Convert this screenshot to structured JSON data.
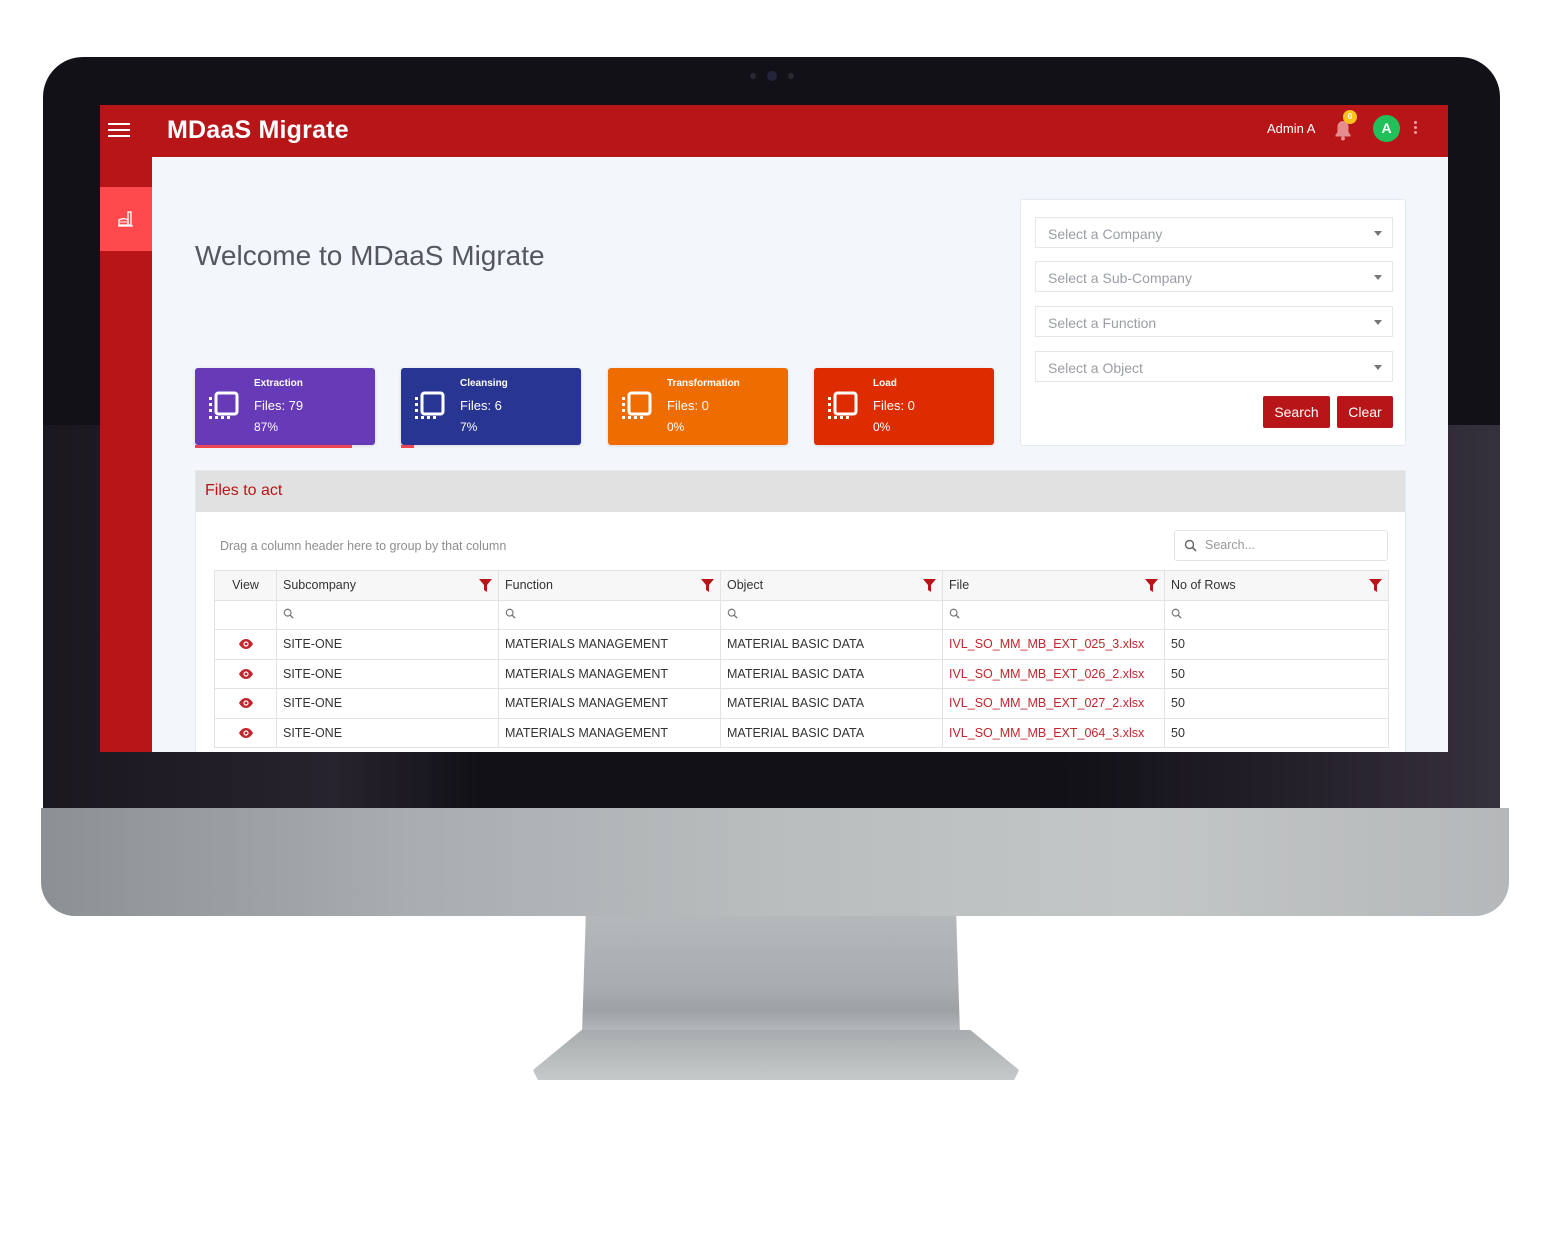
{
  "app": {
    "title": "MDaaS Migrate",
    "user_name": "Admin A",
    "notification_count": "0",
    "avatar_initial": "A",
    "brand_color": "#b71518"
  },
  "sidebar": {
    "items": [
      {
        "icon": "factory-icon",
        "active": true
      }
    ]
  },
  "main": {
    "welcome": "Welcome to MDaaS Migrate",
    "stats": [
      {
        "title": "Extraction",
        "files": "Files: 79",
        "percent_label": "87%",
        "progress": 87,
        "color": "#673ab7"
      },
      {
        "title": "Cleansing",
        "files": "Files: 6",
        "percent_label": "7%",
        "progress": 7,
        "color": "#283593"
      },
      {
        "title": "Transformation",
        "files": "Files: 0",
        "percent_label": "0%",
        "progress": 0,
        "color": "#ef6c00"
      },
      {
        "title": "Load",
        "files": "Files: 0",
        "percent_label": "0%",
        "progress": 0,
        "color": "#dd2c00"
      }
    ]
  },
  "filters": {
    "company_placeholder": "Select a Company",
    "subcompany_placeholder": "Select a Sub-Company",
    "function_placeholder": "Select a Function",
    "object_placeholder": "Select a Object",
    "search_label": "Search",
    "clear_label": "Clear"
  },
  "files_panel": {
    "title": "Files to act",
    "group_hint": "Drag a column header here to group by that column",
    "search_placeholder": "Search...",
    "columns": [
      "View",
      "Subcompany",
      "Function",
      "Object",
      "File",
      "No of Rows"
    ],
    "rows": [
      {
        "subcompany": "SITE-ONE",
        "function": "MATERIALS MANAGEMENT",
        "object": "MATERIAL BASIC DATA",
        "file": "IVL_SO_MM_MB_EXT_025_3.xlsx",
        "rows": "50"
      },
      {
        "subcompany": "SITE-ONE",
        "function": "MATERIALS MANAGEMENT",
        "object": "MATERIAL BASIC DATA",
        "file": "IVL_SO_MM_MB_EXT_026_2.xlsx",
        "rows": "50"
      },
      {
        "subcompany": "SITE-ONE",
        "function": "MATERIALS MANAGEMENT",
        "object": "MATERIAL BASIC DATA",
        "file": "IVL_SO_MM_MB_EXT_027_2.xlsx",
        "rows": "50"
      },
      {
        "subcompany": "SITE-ONE",
        "function": "MATERIALS MANAGEMENT",
        "object": "MATERIAL BASIC DATA",
        "file": "IVL_SO_MM_MB_EXT_064_3.xlsx",
        "rows": "50"
      }
    ]
  }
}
